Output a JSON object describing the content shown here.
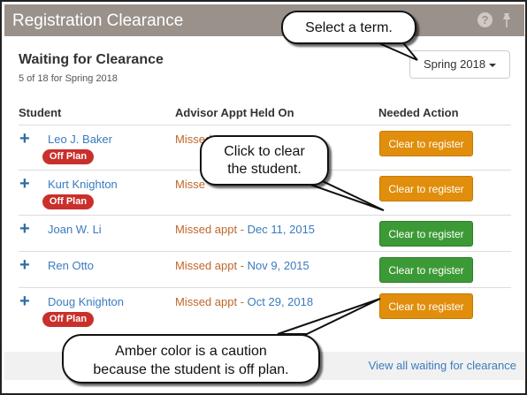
{
  "panel": {
    "title": "Registration Clearance",
    "help_icon": "question-circle-icon",
    "pin_icon": "pin-icon"
  },
  "section": {
    "title": "Waiting for Clearance",
    "subtitle": "5 of 18 for Spring 2018"
  },
  "term_select": {
    "selected": "Spring 2018"
  },
  "columns": {
    "student": "Student",
    "appt": "Advisor Appt Held On",
    "action": "Needed Action"
  },
  "rows": [
    {
      "name": "Leo J. Baker",
      "badge": "Off Plan",
      "appt_missed": "Missed",
      "appt_date": "",
      "action": "Clear to register",
      "action_color": "#e08e0b"
    },
    {
      "name": "Kurt Knighton",
      "badge": "Off Plan",
      "appt_missed": "Misse",
      "appt_date": "",
      "action": "Clear to register",
      "action_color": "#e08e0b"
    },
    {
      "name": "Joan W. Li",
      "badge": "",
      "appt_missed": "Missed appt - ",
      "appt_date": "Dec 11, 2015",
      "action": "Clear to register",
      "action_color": "#3c9a36"
    },
    {
      "name": "Ren Otto",
      "badge": "",
      "appt_missed": "Missed appt - ",
      "appt_date": "Nov 9, 2015",
      "action": "Clear to register",
      "action_color": "#3c9a36"
    },
    {
      "name": "Doug Knighton",
      "badge": "Off Plan",
      "appt_missed": "Missed appt - ",
      "appt_date": "Oct 29, 2018",
      "action": "Clear to register",
      "action_color": "#e08e0b"
    }
  ],
  "footer": {
    "link": "View all waiting for clearance"
  },
  "callouts": {
    "term": "Select a term.",
    "clear_line1": "Click to clear",
    "clear_line2": "the student.",
    "amber_line1": "Amber color is a caution",
    "amber_line2": "because the student is off plan."
  },
  "colors": {
    "header_bg": "#9a918b",
    "amber": "#e08e0b",
    "green": "#3c9a36",
    "offplan": "#c9302c",
    "link": "#3a7bbf",
    "missed": "#c0662b"
  }
}
